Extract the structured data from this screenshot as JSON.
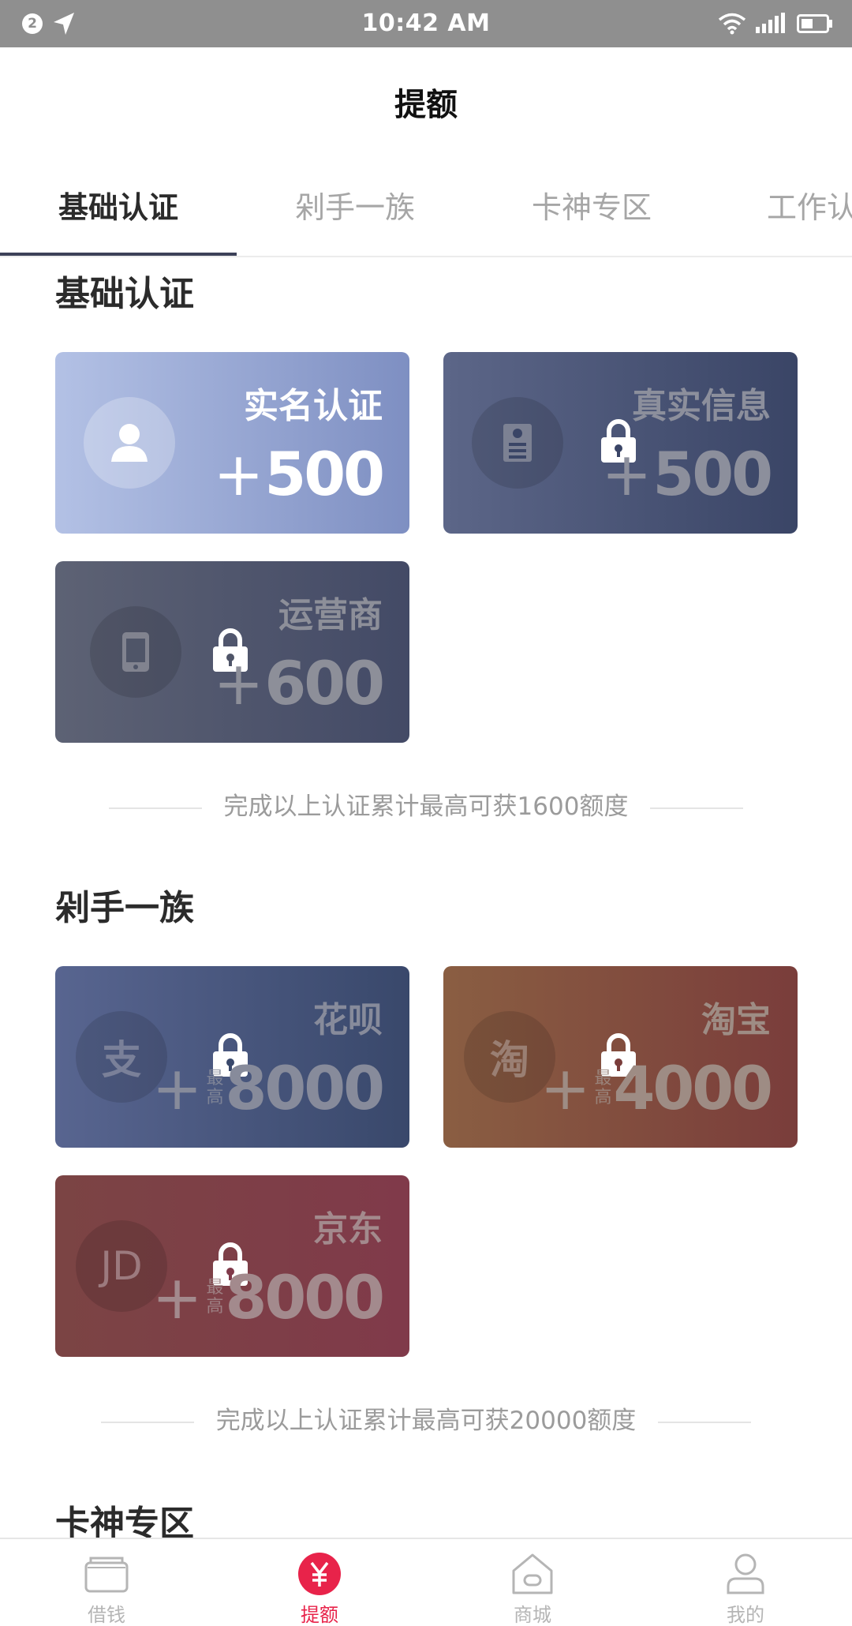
{
  "status_bar": {
    "notification_count": "2",
    "time": "10:42 AM"
  },
  "header": {
    "title": "提额"
  },
  "tabs": [
    {
      "label": "基础认证",
      "active": true
    },
    {
      "label": "剁手一族",
      "active": false
    },
    {
      "label": "卡神专区",
      "active": false
    },
    {
      "label": "工作认证",
      "active": false
    }
  ],
  "sections": [
    {
      "title": "基础认证",
      "cards": [
        {
          "name": "实名认证",
          "plus": "+",
          "amount": "500",
          "locked": false,
          "icon": "user-icon"
        },
        {
          "name": "真实信息",
          "plus": "+",
          "amount": "500",
          "locked": true,
          "icon": "id-card-icon"
        },
        {
          "name": "运营商",
          "plus": "+",
          "amount": "600",
          "locked": true,
          "icon": "phone-icon"
        }
      ],
      "summary": "完成以上认证累计最高可获1600额度"
    },
    {
      "title": "剁手一族",
      "cards": [
        {
          "name": "花呗",
          "plus": "+",
          "max_label": "最高",
          "amount": "8000",
          "locked": true,
          "icon_text": "支"
        },
        {
          "name": "淘宝",
          "plus": "+",
          "max_label": "最高",
          "amount": "4000",
          "locked": true,
          "icon_text": "淘"
        },
        {
          "name": "京东",
          "plus": "+",
          "max_label": "最高",
          "amount": "8000",
          "locked": true,
          "icon_text": "JD"
        }
      ],
      "summary": "完成以上认证累计最高可获20000额度"
    },
    {
      "title": "卡神专区"
    }
  ],
  "bottom_nav": [
    {
      "label": "借钱",
      "icon": "wallet-icon",
      "active": false
    },
    {
      "label": "提额",
      "icon": "yuan-icon",
      "active": true
    },
    {
      "label": "商城",
      "icon": "shop-icon",
      "active": false
    },
    {
      "label": "我的",
      "icon": "profile-icon",
      "active": false
    }
  ],
  "colors": {
    "accent": "#e8234a",
    "status_bar": "#8f8f8f",
    "tab_underline": "#3c4158"
  }
}
